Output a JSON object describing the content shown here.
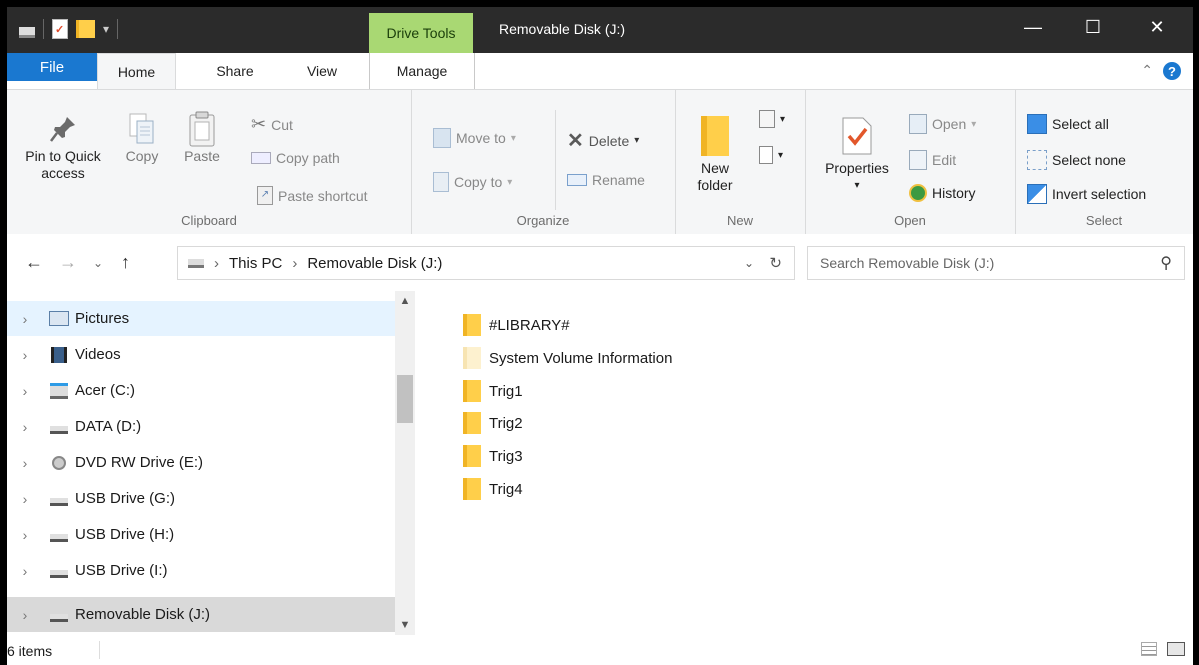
{
  "titlebar": {
    "context_tab": "Drive Tools",
    "title": "Removable Disk (J:)",
    "minimize": "—",
    "maximize": "☐",
    "close": "✕"
  },
  "tabs": {
    "file": "File",
    "home": "Home",
    "share": "Share",
    "view": "View",
    "manage": "Manage"
  },
  "ribbon": {
    "clipboard": {
      "label": "Clipboard",
      "pin_line1": "Pin to Quick",
      "pin_line2": "access",
      "copy": "Copy",
      "paste": "Paste",
      "cut": "Cut",
      "copy_path": "Copy path",
      "paste_shortcut": "Paste shortcut"
    },
    "organize": {
      "label": "Organize",
      "move_to": "Move to",
      "copy_to": "Copy to",
      "delete": "Delete",
      "rename": "Rename"
    },
    "new": {
      "label": "New",
      "new_line1": "New",
      "new_line2": "folder"
    },
    "open": {
      "label": "Open",
      "properties": "Properties",
      "open": "Open",
      "edit": "Edit",
      "history": "History"
    },
    "select": {
      "label": "Select",
      "select_all": "Select all",
      "select_none": "Select none",
      "invert": "Invert selection"
    }
  },
  "address": {
    "crumbs": [
      "This PC",
      "Removable Disk (J:)"
    ],
    "search_placeholder": "Search Removable Disk (J:)"
  },
  "navpane": {
    "items": [
      {
        "label": "Pictures",
        "icon": "pictures-icon"
      },
      {
        "label": "Videos",
        "icon": "videos-icon"
      },
      {
        "label": "Acer (C:)",
        "icon": "windows-drive-icon"
      },
      {
        "label": "DATA (D:)",
        "icon": "drive-icon"
      },
      {
        "label": "DVD RW Drive (E:)",
        "icon": "dvd-drive-icon"
      },
      {
        "label": "USB Drive (G:)",
        "icon": "usb-drive-icon"
      },
      {
        "label": "USB Drive (H:)",
        "icon": "usb-drive-icon"
      },
      {
        "label": "USB Drive (I:)",
        "icon": "usb-drive-icon"
      },
      {
        "label": "Removable Disk (J:)",
        "icon": "removable-disk-icon"
      }
    ]
  },
  "files": [
    {
      "name": "#LIBRARY#"
    },
    {
      "name": "System Volume Information"
    },
    {
      "name": "Trig1"
    },
    {
      "name": "Trig2"
    },
    {
      "name": "Trig3"
    },
    {
      "name": "Trig4"
    }
  ],
  "status": {
    "count": "6 items"
  },
  "colors": {
    "titlebar": "#2b2b2b",
    "drive_tools": "#a9d873",
    "file_tab": "#1a78d0",
    "folder": "#ffcf4a"
  }
}
